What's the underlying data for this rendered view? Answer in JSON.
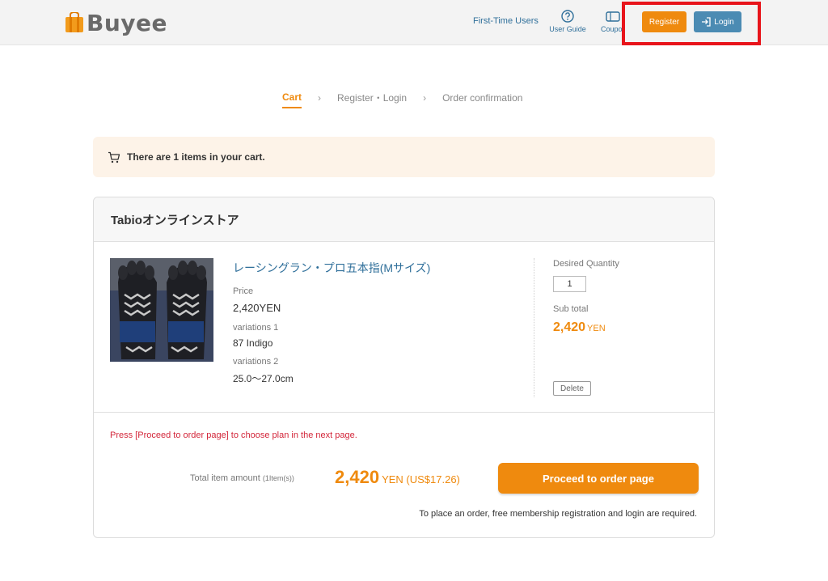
{
  "header": {
    "logo_text": "Buyee",
    "first_time_users": "First-Time Users",
    "user_guide": "User Guide",
    "coupon": "Coupo",
    "register_label": "Register",
    "login_label": "Login"
  },
  "steps": {
    "cart": "Cart",
    "register_login": "Register・Login",
    "order_confirmation": "Order confirmation"
  },
  "notice": {
    "text": "There are 1 items in your cart."
  },
  "store": {
    "name": "Tabioオンラインストア"
  },
  "item": {
    "title": "レーシングラン・プロ五本指(Mサイズ)",
    "price_label": "Price",
    "price_value": "2,420YEN",
    "variation1_label": "variations 1",
    "variation1_value": "87 Indigo",
    "variation2_label": "variations 2",
    "variation2_value": "25.0～27.0cm",
    "quantity_label": "Desired Quantity",
    "quantity_value": "1",
    "subtotal_label": "Sub total",
    "subtotal_value": "2,420",
    "subtotal_currency": "YEN",
    "delete_label": "Delete"
  },
  "summary": {
    "instruction": "Press [Proceed to order page] to choose plan in the next page.",
    "total_label": "Total item amount",
    "total_count": "(1Item(s))",
    "total_value": "2,420",
    "total_currency": "YEN (US$17.26)",
    "proceed_label": "Proceed to order page",
    "order_note": "To place an order, free membership registration and login are required."
  },
  "colors": {
    "accent_orange": "#ef8a0e",
    "login_blue": "#4b8bb3",
    "highlight_red": "#e8141b",
    "warning_red": "#d3263a"
  }
}
